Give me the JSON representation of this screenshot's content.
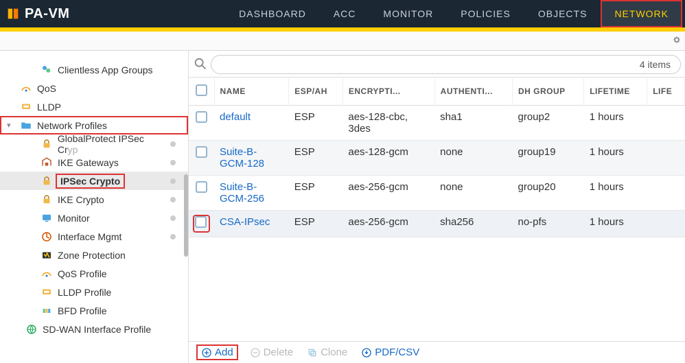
{
  "brand": "PA-VM",
  "nav": {
    "tabs": [
      {
        "label": "DASHBOARD",
        "active": false
      },
      {
        "label": "ACC",
        "active": false
      },
      {
        "label": "MONITOR",
        "active": false
      },
      {
        "label": "POLICIES",
        "active": false
      },
      {
        "label": "OBJECTS",
        "active": false
      },
      {
        "label": "NETWORK",
        "active": true
      }
    ]
  },
  "sidebar": {
    "items": [
      {
        "label": "Clientless App Groups",
        "level": 2,
        "icon": "groups",
        "dot": false
      },
      {
        "label": "QoS",
        "level": 0,
        "icon": "qos",
        "dot": false
      },
      {
        "label": "LLDP",
        "level": 0,
        "icon": "lldp",
        "dot": false
      },
      {
        "label": "Network Profiles",
        "level": 0,
        "icon": "folder",
        "expandable": true,
        "highlight": true
      },
      {
        "label": "GlobalProtect IPSec Crypto",
        "level": 2,
        "icon": "lock",
        "dot": true,
        "truncate": true
      },
      {
        "label": "IKE Gateways",
        "level": 2,
        "icon": "gateway",
        "dot": true
      },
      {
        "label": "IPSec Crypto",
        "level": 2,
        "icon": "lock",
        "dot": true,
        "selected": true,
        "highlight_label": true
      },
      {
        "label": "IKE Crypto",
        "level": 2,
        "icon": "lock",
        "dot": true
      },
      {
        "label": "Monitor",
        "level": 2,
        "icon": "monitor",
        "dot": true
      },
      {
        "label": "Interface Mgmt",
        "level": 2,
        "icon": "ifmgmt",
        "dot": true
      },
      {
        "label": "Zone Protection",
        "level": 2,
        "icon": "zone",
        "dot": false
      },
      {
        "label": "QoS Profile",
        "level": 2,
        "icon": "qos",
        "dot": false
      },
      {
        "label": "LLDP Profile",
        "level": 2,
        "icon": "lldp",
        "dot": false
      },
      {
        "label": "BFD Profile",
        "level": 2,
        "icon": "bfd",
        "dot": false
      },
      {
        "label": "SD-WAN Interface Profile",
        "level": 1,
        "icon": "sdwan",
        "dot": false
      }
    ]
  },
  "search": {
    "count_text": "4 items"
  },
  "grid": {
    "columns": [
      "",
      "NAME",
      "ESP/AH",
      "ENCRYPTI...",
      "AUTHENTI...",
      "DH GROUP",
      "LIFETIME",
      "LIFE"
    ],
    "rows": [
      {
        "name": "default",
        "esp": "ESP",
        "enc": "aes-128-cbc, 3des",
        "auth": "sha1",
        "dh": "group2",
        "life": "1 hours"
      },
      {
        "name": "Suite-B-GCM-128",
        "esp": "ESP",
        "enc": "aes-128-gcm",
        "auth": "none",
        "dh": "group19",
        "life": "1 hours"
      },
      {
        "name": "Suite-B-GCM-256",
        "esp": "ESP",
        "enc": "aes-256-gcm",
        "auth": "none",
        "dh": "group20",
        "life": "1 hours"
      },
      {
        "name": "CSA-IPsec",
        "esp": "ESP",
        "enc": "aes-256-gcm",
        "auth": "sha256",
        "dh": "no-pfs",
        "life": "1 hours",
        "highlight": true
      }
    ]
  },
  "footer": {
    "add": "Add",
    "delete": "Delete",
    "clone": "Clone",
    "pdf": "PDF/CSV"
  }
}
